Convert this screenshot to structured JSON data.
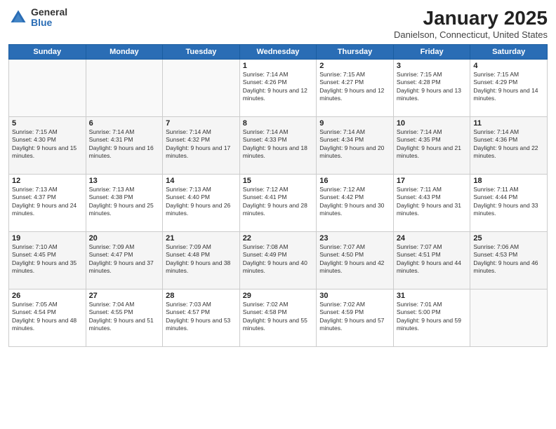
{
  "logo": {
    "general": "General",
    "blue": "Blue"
  },
  "title": "January 2025",
  "subtitle": "Danielson, Connecticut, United States",
  "days_of_week": [
    "Sunday",
    "Monday",
    "Tuesday",
    "Wednesday",
    "Thursday",
    "Friday",
    "Saturday"
  ],
  "weeks": [
    [
      {
        "day": null
      },
      {
        "day": null
      },
      {
        "day": null
      },
      {
        "day": "1",
        "sunrise": "7:14 AM",
        "sunset": "4:26 PM",
        "daylight": "9 hours and 12 minutes."
      },
      {
        "day": "2",
        "sunrise": "7:15 AM",
        "sunset": "4:27 PM",
        "daylight": "9 hours and 12 minutes."
      },
      {
        "day": "3",
        "sunrise": "7:15 AM",
        "sunset": "4:28 PM",
        "daylight": "9 hours and 13 minutes."
      },
      {
        "day": "4",
        "sunrise": "7:15 AM",
        "sunset": "4:29 PM",
        "daylight": "9 hours and 14 minutes."
      }
    ],
    [
      {
        "day": "5",
        "sunrise": "7:15 AM",
        "sunset": "4:30 PM",
        "daylight": "9 hours and 15 minutes."
      },
      {
        "day": "6",
        "sunrise": "7:14 AM",
        "sunset": "4:31 PM",
        "daylight": "9 hours and 16 minutes."
      },
      {
        "day": "7",
        "sunrise": "7:14 AM",
        "sunset": "4:32 PM",
        "daylight": "9 hours and 17 minutes."
      },
      {
        "day": "8",
        "sunrise": "7:14 AM",
        "sunset": "4:33 PM",
        "daylight": "9 hours and 18 minutes."
      },
      {
        "day": "9",
        "sunrise": "7:14 AM",
        "sunset": "4:34 PM",
        "daylight": "9 hours and 20 minutes."
      },
      {
        "day": "10",
        "sunrise": "7:14 AM",
        "sunset": "4:35 PM",
        "daylight": "9 hours and 21 minutes."
      },
      {
        "day": "11",
        "sunrise": "7:14 AM",
        "sunset": "4:36 PM",
        "daylight": "9 hours and 22 minutes."
      }
    ],
    [
      {
        "day": "12",
        "sunrise": "7:13 AM",
        "sunset": "4:37 PM",
        "daylight": "9 hours and 24 minutes."
      },
      {
        "day": "13",
        "sunrise": "7:13 AM",
        "sunset": "4:38 PM",
        "daylight": "9 hours and 25 minutes."
      },
      {
        "day": "14",
        "sunrise": "7:13 AM",
        "sunset": "4:40 PM",
        "daylight": "9 hours and 26 minutes."
      },
      {
        "day": "15",
        "sunrise": "7:12 AM",
        "sunset": "4:41 PM",
        "daylight": "9 hours and 28 minutes."
      },
      {
        "day": "16",
        "sunrise": "7:12 AM",
        "sunset": "4:42 PM",
        "daylight": "9 hours and 30 minutes."
      },
      {
        "day": "17",
        "sunrise": "7:11 AM",
        "sunset": "4:43 PM",
        "daylight": "9 hours and 31 minutes."
      },
      {
        "day": "18",
        "sunrise": "7:11 AM",
        "sunset": "4:44 PM",
        "daylight": "9 hours and 33 minutes."
      }
    ],
    [
      {
        "day": "19",
        "sunrise": "7:10 AM",
        "sunset": "4:45 PM",
        "daylight": "9 hours and 35 minutes."
      },
      {
        "day": "20",
        "sunrise": "7:09 AM",
        "sunset": "4:47 PM",
        "daylight": "9 hours and 37 minutes."
      },
      {
        "day": "21",
        "sunrise": "7:09 AM",
        "sunset": "4:48 PM",
        "daylight": "9 hours and 38 minutes."
      },
      {
        "day": "22",
        "sunrise": "7:08 AM",
        "sunset": "4:49 PM",
        "daylight": "9 hours and 40 minutes."
      },
      {
        "day": "23",
        "sunrise": "7:07 AM",
        "sunset": "4:50 PM",
        "daylight": "9 hours and 42 minutes."
      },
      {
        "day": "24",
        "sunrise": "7:07 AM",
        "sunset": "4:51 PM",
        "daylight": "9 hours and 44 minutes."
      },
      {
        "day": "25",
        "sunrise": "7:06 AM",
        "sunset": "4:53 PM",
        "daylight": "9 hours and 46 minutes."
      }
    ],
    [
      {
        "day": "26",
        "sunrise": "7:05 AM",
        "sunset": "4:54 PM",
        "daylight": "9 hours and 48 minutes."
      },
      {
        "day": "27",
        "sunrise": "7:04 AM",
        "sunset": "4:55 PM",
        "daylight": "9 hours and 51 minutes."
      },
      {
        "day": "28",
        "sunrise": "7:03 AM",
        "sunset": "4:57 PM",
        "daylight": "9 hours and 53 minutes."
      },
      {
        "day": "29",
        "sunrise": "7:02 AM",
        "sunset": "4:58 PM",
        "daylight": "9 hours and 55 minutes."
      },
      {
        "day": "30",
        "sunrise": "7:02 AM",
        "sunset": "4:59 PM",
        "daylight": "9 hours and 57 minutes."
      },
      {
        "day": "31",
        "sunrise": "7:01 AM",
        "sunset": "5:00 PM",
        "daylight": "9 hours and 59 minutes."
      },
      {
        "day": null
      }
    ]
  ]
}
